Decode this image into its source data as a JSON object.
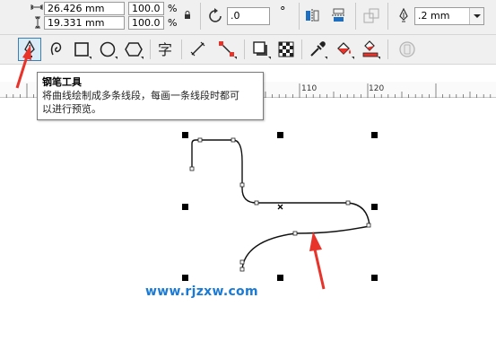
{
  "property_bar": {
    "width_value": "26.426 mm",
    "height_value": "19.331 mm",
    "scale_x": "100.0",
    "scale_y": "100.0",
    "percent_x": "%",
    "percent_y": "%",
    "rotation_value": ".0",
    "degree_symbol": "°",
    "outline_width": ".2 mm",
    "icons": [
      "width-icon",
      "height-icon",
      "lock-ratio-icon",
      "rotation-icon",
      "mirror-horizontal-icon",
      "mirror-vertical-icon",
      "convert-icon",
      "outline-pen-icon",
      "dropdown-arrow-icon"
    ]
  },
  "toolbox": {
    "tools": [
      {
        "name": "pen-tool",
        "active": true
      },
      {
        "name": "bspline-tool",
        "active": false
      },
      {
        "name": "rectangle-tool",
        "active": false
      },
      {
        "name": "ellipse-tool",
        "active": false
      },
      {
        "name": "polygon-tool",
        "active": false
      },
      {
        "name": "text-tool",
        "active": false
      },
      {
        "name": "parallel-dimension-tool",
        "active": false
      },
      {
        "name": "connector-tool",
        "active": false
      },
      {
        "name": "drop-shadow-tool",
        "active": false
      },
      {
        "name": "transparency-tool",
        "active": false
      },
      {
        "name": "color-eyedropper-tool",
        "active": false
      },
      {
        "name": "interactive-fill-tool",
        "active": false
      },
      {
        "name": "smart-fill-tool",
        "active": false
      },
      {
        "name": "disabled-tool",
        "active": false
      }
    ]
  },
  "tooltip": {
    "title": "钢笔工具",
    "description_line1": "将曲线绘制成多条线段，每画一条线段时都可",
    "description_line2": "以进行预览。"
  },
  "ruler": {
    "labels": [
      "110",
      "120"
    ]
  },
  "watermark": "www.rjzxw.com",
  "colors": {
    "annotation_arrow": "#e8332a",
    "watermark": "#1a7bd6",
    "active_tool_border": "#3c7fb1"
  }
}
